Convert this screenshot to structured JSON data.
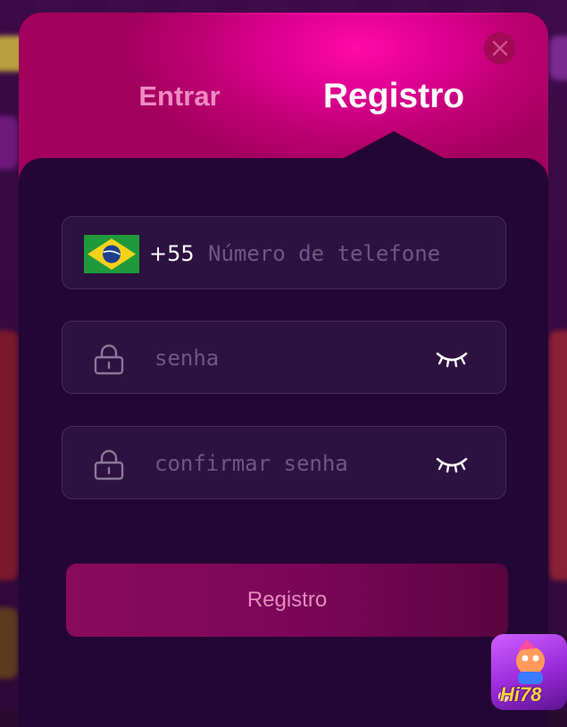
{
  "modal": {
    "tabs": [
      {
        "label": "Entrar",
        "active": false
      },
      {
        "label": "Registro",
        "active": true
      }
    ],
    "close_icon": "close-icon"
  },
  "form": {
    "phone": {
      "country_flag": "brazil-flag-icon",
      "dial_code": "+55",
      "placeholder": "Número de telefone",
      "value": ""
    },
    "password": {
      "placeholder": "senha",
      "value": "",
      "lock_icon": "lock-icon",
      "toggle_icon": "eye-closed-icon"
    },
    "confirm_password": {
      "placeholder": "confirmar senha",
      "value": "",
      "lock_icon": "lock-icon",
      "toggle_icon": "eye-closed-icon"
    },
    "submit_label": "Registro"
  },
  "badge": {
    "text": "Hi78"
  },
  "colors": {
    "header_accent": "#e00093",
    "modal_bg": "#230634",
    "field_bg": "#2d1140",
    "button_gradient_start": "#8a0a5c",
    "inactive_tab": "#f08ac4"
  }
}
